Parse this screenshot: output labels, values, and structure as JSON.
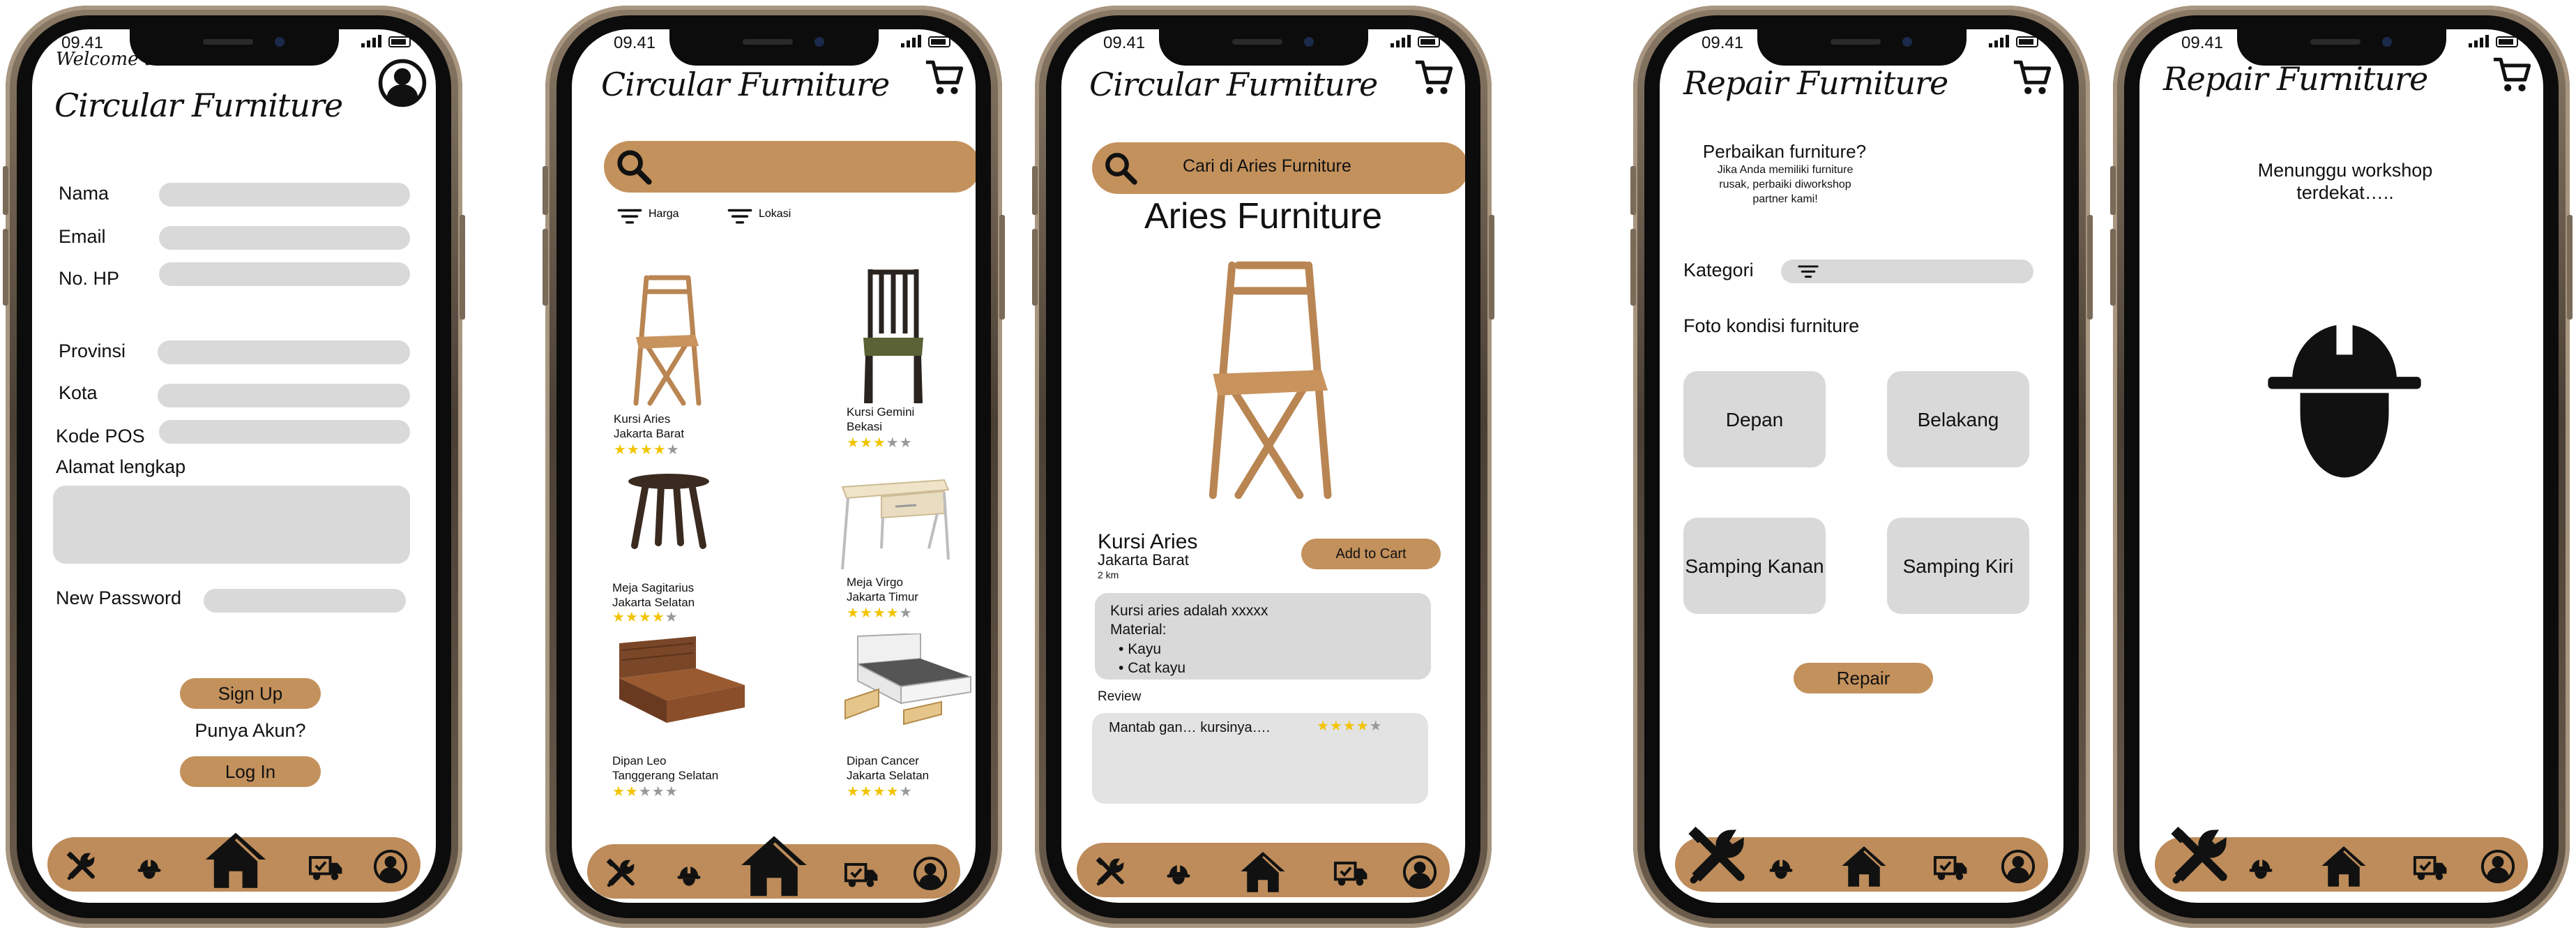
{
  "status_time": "09.41",
  "accent_color": "#c3915c",
  "screens": {
    "signup": {
      "welcome": "Welcome to",
      "title": "Circular Furniture",
      "fields": {
        "nama": "Nama",
        "email": "Email",
        "no_hp": "No. HP",
        "provinsi": "Provinsi",
        "kota": "Kota",
        "kode_pos": "Kode POS",
        "alamat": "Alamat lengkap",
        "new_password": "New Password"
      },
      "signup_button": "Sign Up",
      "have_account": "Punya Akun?",
      "login_button": "Log In"
    },
    "catalog": {
      "title": "Circular Furniture",
      "filters": [
        "Harga",
        "Lokasi"
      ],
      "products": [
        {
          "name": "Kursi Aries",
          "location": "Jakarta Barat",
          "rating": 4
        },
        {
          "name": "Kursi Gemini",
          "location": "Bekasi",
          "rating": 3
        },
        {
          "name": "Meja Sagitarius",
          "location": "Jakarta Selatan",
          "rating": 4
        },
        {
          "name": "Meja Virgo",
          "location": "Jakarta Timur",
          "rating": 4
        },
        {
          "name": "Dipan Leo",
          "location": "Tanggerang Selatan",
          "rating": 2
        },
        {
          "name": "Dipan Cancer",
          "location": "Jakarta Selatan",
          "rating": 4
        }
      ]
    },
    "store": {
      "title": "Circular Furniture",
      "search_placeholder": "Cari di Aries Furniture",
      "store_name": "Aries Furniture",
      "product_name": "Kursi Aries",
      "product_location": "Jakarta Barat",
      "product_distance": "2 km",
      "add_to_cart": "Add to Cart",
      "description": "Kursi aries adalah xxxxx",
      "material_label": "Material:",
      "materials": [
        "Kayu",
        "Cat kayu"
      ],
      "review_label": "Review",
      "review_text": "Mantab gan… kursinya….",
      "review_rating": 4
    },
    "repair": {
      "title": "Repair Furniture",
      "question": "Perbaikan furniture?",
      "subtitle": "Jika Anda memiliki furniture rusak, perbaiki diworkshop partner kami!",
      "kategori": "Kategori",
      "foto_label": "Foto kondisi furniture",
      "photo_buttons": [
        "Depan",
        "Belakang",
        "Samping Kanan",
        "Samping Kiri"
      ],
      "repair_button": "Repair"
    },
    "waiting": {
      "title": "Repair Furniture",
      "message": "Menunggu workshop terdekat….."
    }
  },
  "nav_icons": [
    "tools-icon",
    "helmet-icon",
    "home-icon",
    "delivery-truck-icon",
    "profile-icon"
  ]
}
